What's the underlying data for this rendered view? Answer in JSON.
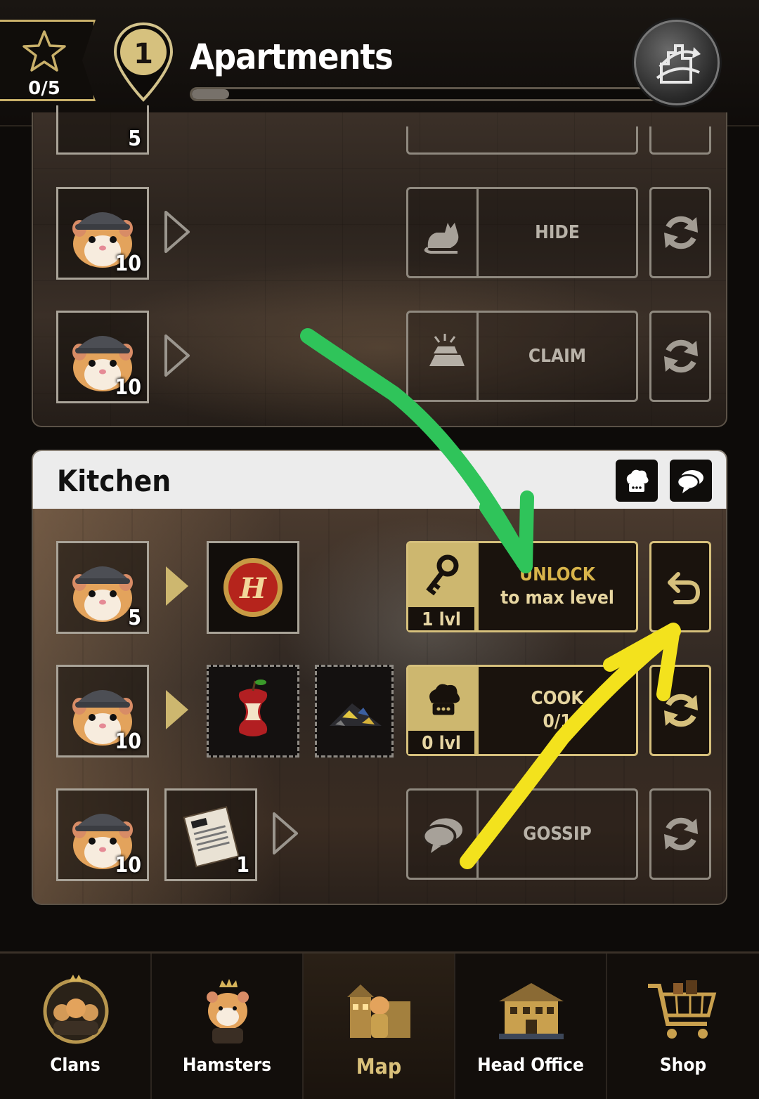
{
  "header": {
    "stars": "0/5",
    "location_number": "1",
    "title": "Apartments",
    "progress": 0.08
  },
  "top_room": {
    "rows": [
      {
        "hamster_count": "5"
      },
      {
        "hamster_count": "10",
        "action": "HIDE",
        "action_icon": "cat-icon"
      },
      {
        "hamster_count": "10",
        "action": "CLAIM",
        "action_icon": "gold-bar-icon"
      }
    ]
  },
  "kitchen": {
    "name": "Kitchen",
    "rows": [
      {
        "hamster_count": "5",
        "reward_icon": "h-coin-icon",
        "action": "UNLOCK",
        "action_sub": "to max level",
        "level": "1 lvl",
        "action_icon": "key-icon",
        "side_button_icon": "undo-icon"
      },
      {
        "hamster_count": "10",
        "ingredients": [
          "apple-core-icon",
          "scrap-pile-icon"
        ],
        "action": "COOK",
        "action_sub": "0/1",
        "level": "0 lvl",
        "action_icon": "chef-hat-icon",
        "side_button_icon": "refresh-icon"
      },
      {
        "hamster_count": "10",
        "item_icon": "newspaper-icon",
        "item_count": "1",
        "action": "GOSSIP",
        "action_icon": "chat-icon",
        "side_button_icon": "refresh-icon"
      }
    ]
  },
  "nav": {
    "items": [
      {
        "label": "Clans"
      },
      {
        "label": "Hamsters"
      },
      {
        "label": "Map",
        "active": true
      },
      {
        "label": "Head Office"
      },
      {
        "label": "Shop"
      }
    ]
  },
  "colors": {
    "gold": "#cdb76f",
    "green_arrow": "#2fc45a",
    "yellow_arrow": "#f3e21d"
  }
}
